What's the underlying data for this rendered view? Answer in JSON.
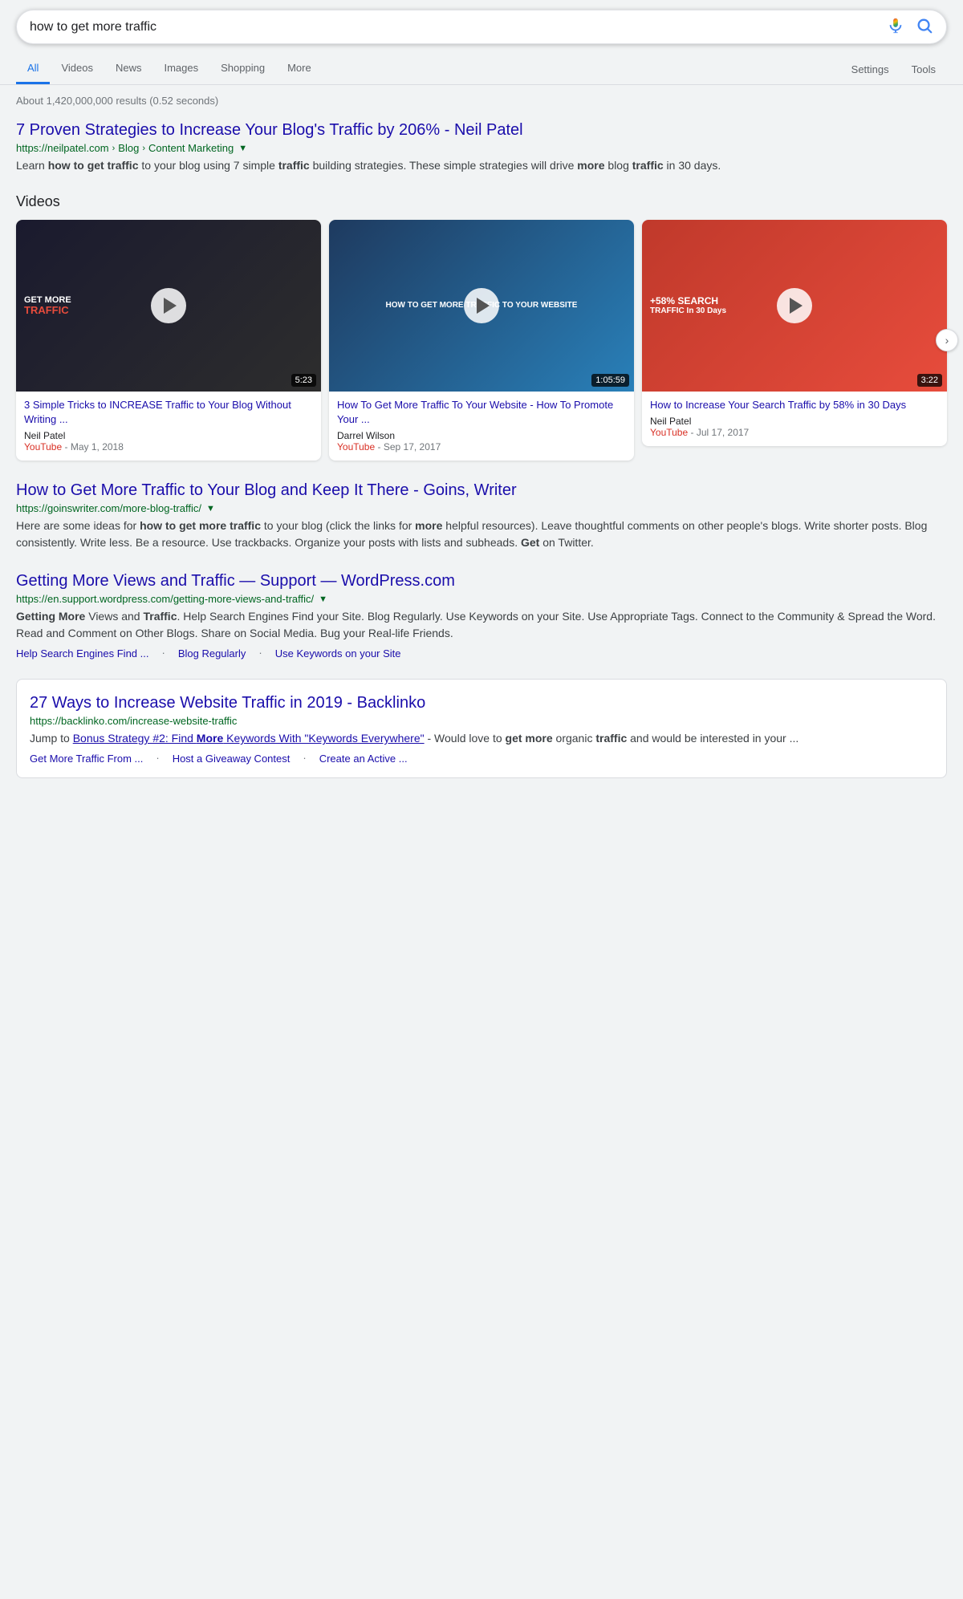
{
  "search": {
    "query": "how to get more traffic",
    "mic_label": "Voice Search",
    "search_button_label": "Google Search"
  },
  "tabs": [
    {
      "id": "all",
      "label": "All",
      "active": true
    },
    {
      "id": "videos",
      "label": "Videos",
      "active": false
    },
    {
      "id": "news",
      "label": "News",
      "active": false
    },
    {
      "id": "images",
      "label": "Images",
      "active": false
    },
    {
      "id": "shopping",
      "label": "Shopping",
      "active": false
    },
    {
      "id": "more",
      "label": "More",
      "active": false
    }
  ],
  "settings_label": "Settings",
  "tools_label": "Tools",
  "results_count": "About 1,420,000,000 results (0.52 seconds)",
  "results": [
    {
      "id": "result1",
      "title": "7 Proven Strategies to Increase Your Blog's Traffic by 206% - Neil Patel",
      "url": "https://neilpatel.com",
      "breadcrumb": "Blog › Content Marketing",
      "has_dropdown": true,
      "snippet": "Learn <strong>how to get traffic</strong> to your blog using 7 simple <strong>traffic</strong> building strategies. These simple strategies will drive <strong>more</strong> blog <strong>traffic</strong> in 30 days."
    }
  ],
  "videos_section": {
    "title": "Videos",
    "videos": [
      {
        "id": "v1",
        "title": "3 Simple Tricks to INCREASE Traffic to Your Blog Without Writing ...",
        "duration": "5:23",
        "author": "Neil Patel",
        "source": "YouTube",
        "date": "May 1, 2018",
        "thumb_type": "v1",
        "thumb_label1": "GET MORE",
        "thumb_label2": "TRAFFIC"
      },
      {
        "id": "v2",
        "title": "How To Get More Traffic To Your Website - How To Promote Your ...",
        "duration": "1:05:59",
        "author": "Darrel Wilson",
        "source": "YouTube",
        "date": "Sep 17, 2017",
        "thumb_type": "v2",
        "thumb_label": "HOW TO GET MORE TRAFFIC TO YOUR WEBSITE"
      },
      {
        "id": "v3",
        "title": "How to Increase Your Search Traffic by 58% in 30 Days",
        "duration": "3:22",
        "author": "Neil Patel",
        "source": "YouTube",
        "date": "Jul 17, 2017",
        "thumb_type": "v3",
        "thumb_label": "+58% SEARCH TRAFFIC In 30 Days"
      }
    ]
  },
  "organic_results": [
    {
      "id": "org1",
      "title": "How to Get More Traffic to Your Blog and Keep It There - Goins, Writer",
      "url": "https://goinswriter.com/more-blog-traffic/",
      "has_dropdown": true,
      "snippet": "Here are some ideas for <strong>how to get more traffic</strong> to your blog (click the links for <strong>more</strong> helpful resources). Leave thoughtful comments on other people's blogs. Write shorter posts. Blog consistently. Write less. Be a resource. Use trackbacks. Organize your posts with lists and subheads. <strong>Get</strong> on Twitter.",
      "highlighted": false,
      "sitelinks": []
    },
    {
      "id": "org2",
      "title": "Getting More Views and Traffic — Support — WordPress.com",
      "url": "https://en.support.wordpress.com/getting-more-views-and-traffic/",
      "has_dropdown": true,
      "snippet": "<strong>Getting More</strong> Views and <strong>Traffic</strong>. Help Search Engines Find your Site. Blog Regularly. Use Keywords on your Site. Use Appropriate Tags. Connect to the Community & Spread the Word. Read and Comment on Other Blogs. Share on Social Media. Bug your Real-life Friends.",
      "highlighted": false,
      "sitelinks": [
        {
          "text": "Help Search Engines Find ..."
        },
        {
          "text": "Blog Regularly"
        },
        {
          "text": "Use Keywords on your Site"
        }
      ]
    },
    {
      "id": "org3",
      "title": "27 Ways to Increase Website Traffic in 2019 - Backlinko",
      "url": "https://backlinko.com/increase-website-traffic",
      "has_dropdown": false,
      "snippet": "Jump to <a href='#' style='color:#1a0dab'>Bonus Strategy #2: Find <strong>More</strong> Keywords With \"Keywords Everywhere\"</a> - Would love to <strong>get more</strong> organic <strong>traffic</strong> and would be interested in your ...",
      "highlighted": true,
      "sitelinks": [
        {
          "text": "Get More Traffic From ..."
        },
        {
          "text": "Host a Giveaway Contest"
        },
        {
          "text": "Create an Active ..."
        }
      ]
    }
  ]
}
